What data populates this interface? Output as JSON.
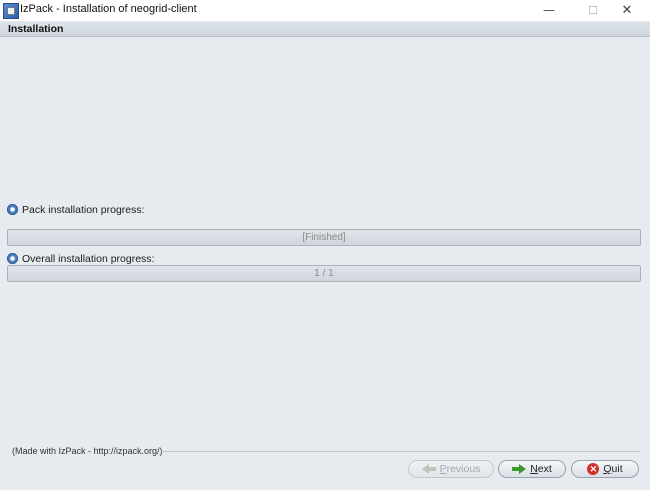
{
  "window": {
    "title": "IzPack - Installation of  neogrid-client",
    "minimize_glyph": "—",
    "maximize_glyph": "☐",
    "close_glyph": "✕"
  },
  "panel": {
    "header": "Installation"
  },
  "pack_progress": {
    "label": "Pack installation progress:",
    "text": "[Finished]"
  },
  "overall_progress": {
    "label": "Overall installation progress:",
    "text": "1 / 1"
  },
  "footer": {
    "made_with": "(Made with IzPack - http://izpack.org/)"
  },
  "buttons": {
    "previous": {
      "label_prefix": "",
      "label_underline": "P",
      "label_rest": "revious",
      "enabled": false
    },
    "next": {
      "label_prefix": "",
      "label_underline": "N",
      "label_rest": "ext",
      "enabled": true
    },
    "quit": {
      "label_prefix": "",
      "label_underline": "Q",
      "label_rest": "uit",
      "enabled": true
    }
  },
  "icons": {
    "app": "izpack-app-icon",
    "progress": "gear-icon",
    "previous": "arrow-left-icon",
    "next": "arrow-right-icon",
    "quit": "quit-x-icon"
  }
}
